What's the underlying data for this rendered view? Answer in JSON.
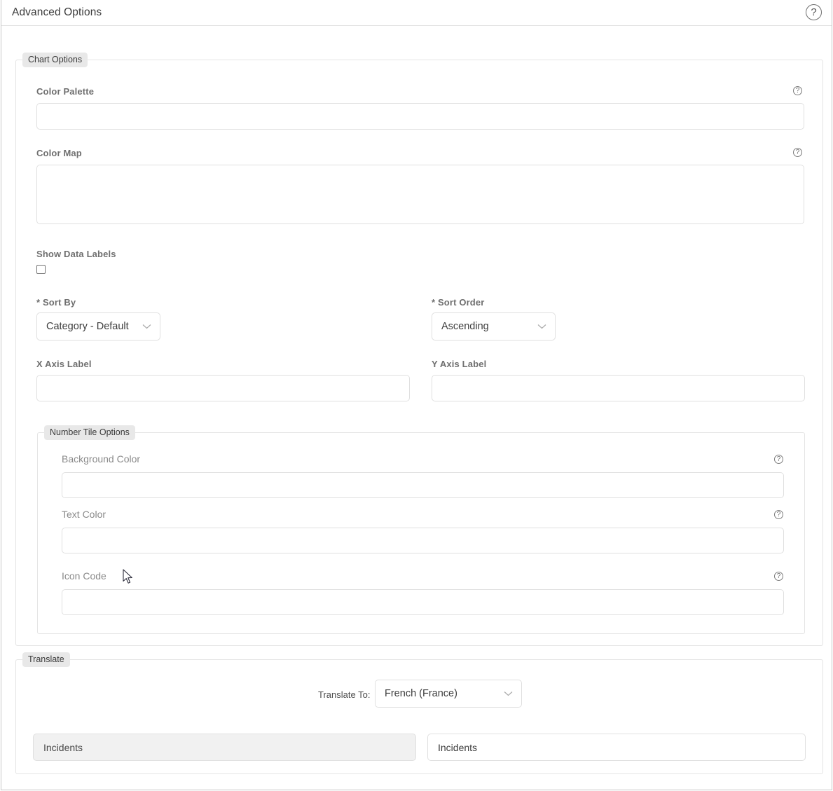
{
  "header": {
    "title": "Advanced Options",
    "help_icon": "help-circle-icon",
    "help_glyph": "?"
  },
  "chart_options": {
    "legend": "Chart Options",
    "fields": {
      "color_palette": {
        "label": "Color Palette",
        "value": "",
        "placeholder": "",
        "help_glyph": "?"
      },
      "color_map": {
        "label": "Color Map",
        "value": "",
        "placeholder": "",
        "help_glyph": "?"
      },
      "show_data_labels": {
        "label": "Show Data Labels",
        "checked": false
      },
      "sort_by": {
        "label": "* Sort By",
        "value": "Category - Default",
        "chevron_icon": "chevron-down-icon"
      },
      "sort_order": {
        "label": "* Sort Order",
        "value": "Ascending",
        "chevron_icon": "chevron-down-icon"
      },
      "x_axis_label": {
        "label": "X Axis Label",
        "value": "",
        "placeholder": ""
      },
      "y_axis_label": {
        "label": "Y Axis Label",
        "value": "",
        "placeholder": ""
      }
    },
    "number_tile_options": {
      "legend": "Number Tile Options",
      "fields": {
        "background_color": {
          "label": "Background Color",
          "value": "",
          "placeholder": "",
          "help_glyph": "?"
        },
        "text_color": {
          "label": "Text Color",
          "value": "",
          "placeholder": "",
          "help_glyph": "?"
        },
        "icon_code": {
          "label": "Icon Code",
          "value": "",
          "placeholder": "",
          "help_glyph": "?"
        }
      }
    }
  },
  "translate": {
    "legend": "Translate",
    "translate_to_label": "Translate To:",
    "translate_to_value": "French (France)",
    "chevron_icon": "chevron-down-icon",
    "source_value": "Incidents",
    "target_value": "Incidents"
  },
  "colors": {
    "panel_border": "#c8c8c8",
    "fieldset_border": "#e4e4e4",
    "legend_bg": "#e8e8e8",
    "label_strong": "#6f6f6f",
    "label_light": "#8a8a8a",
    "input_border": "#e0e0e0",
    "disabled_bg": "#f1f1f1",
    "title_text": "#3b3b3b"
  }
}
